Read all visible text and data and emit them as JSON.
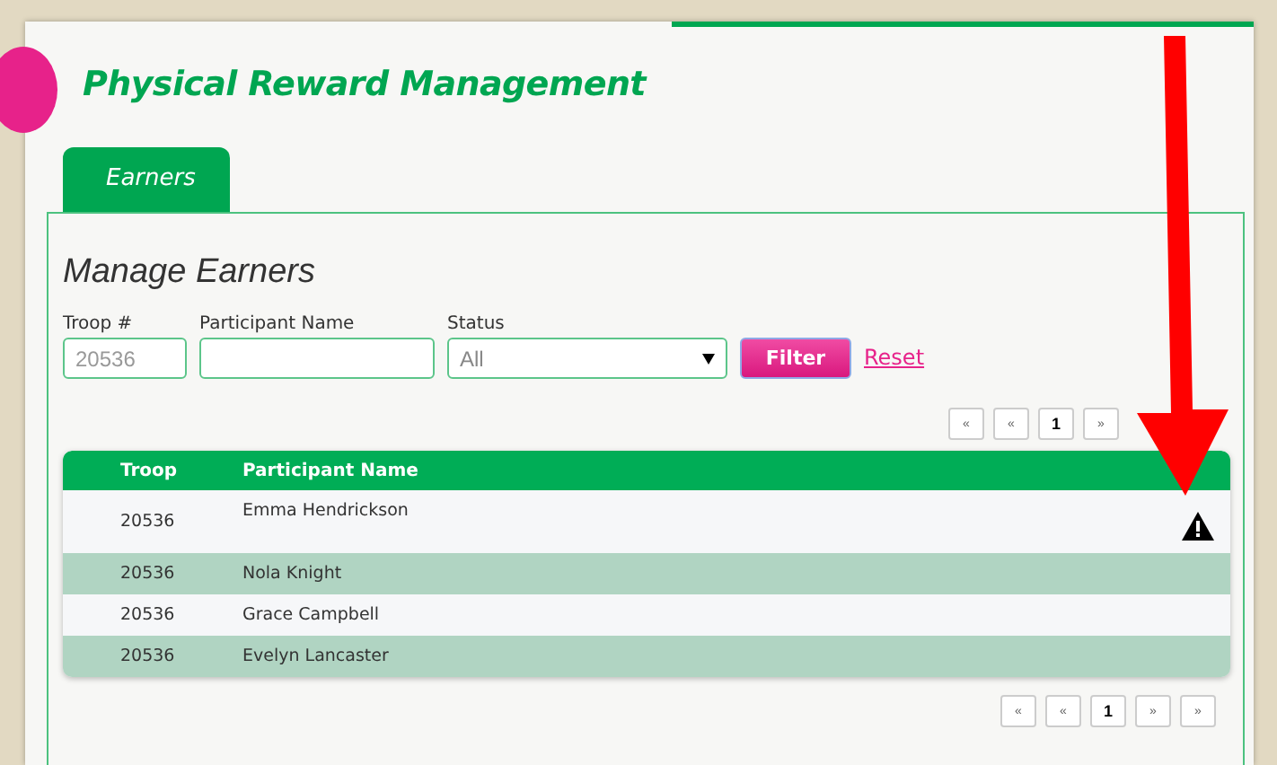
{
  "header": {
    "title": "Physical Reward Management"
  },
  "tabs": [
    {
      "label": "Earners",
      "selected": true
    }
  ],
  "section": {
    "heading": "Manage Earners"
  },
  "filters": {
    "troop": {
      "label": "Troop #",
      "placeholder": "20536"
    },
    "participant": {
      "label": "Participant Name"
    },
    "status": {
      "label": "Status",
      "value": "All"
    },
    "filter_button": "Filter",
    "reset_link": "Reset"
  },
  "pager_top": [
    {
      "label": "«",
      "selected": false
    },
    {
      "label": "«",
      "selected": false
    },
    {
      "label": "1",
      "selected": true
    },
    {
      "label": "»",
      "selected": false
    }
  ],
  "table": {
    "columns": [
      "Troop",
      "Participant Name"
    ],
    "rows": [
      {
        "troop": "20536",
        "name": "Emma Hendrickson",
        "warning": true
      },
      {
        "troop": "20536",
        "name": "Nola Knight",
        "warning": false
      },
      {
        "troop": "20536",
        "name": "Grace Campbell",
        "warning": false
      },
      {
        "troop": "20536",
        "name": "Evelyn Lancaster",
        "warning": false
      }
    ]
  },
  "pager_bottom": [
    {
      "label": "«",
      "selected": false
    },
    {
      "label": "«",
      "selected": false
    },
    {
      "label": "1",
      "selected": true
    },
    {
      "label": "»",
      "selected": false
    },
    {
      "label": "»",
      "selected": false
    }
  ]
}
